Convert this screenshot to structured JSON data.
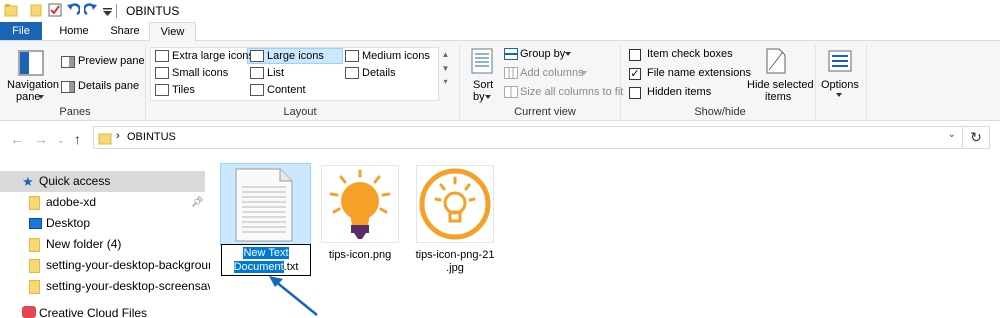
{
  "window": {
    "title": "OBINTUS"
  },
  "tabs": {
    "file": "File",
    "home": "Home",
    "share": "Share",
    "view": "View"
  },
  "ribbon": {
    "panes": {
      "label": "Panes",
      "navigation_pane_line1": "Navigation",
      "navigation_pane_line2": "pane",
      "preview_pane": "Preview pane",
      "details_pane": "Details pane"
    },
    "layout": {
      "label": "Layout",
      "extra_large_icons": "Extra large icons",
      "large_icons": "Large icons",
      "medium_icons": "Medium icons",
      "small_icons": "Small icons",
      "list": "List",
      "details": "Details",
      "tiles": "Tiles",
      "content": "Content",
      "selected": "Large icons"
    },
    "current_view": {
      "label": "Current view",
      "sort_by_line1": "Sort",
      "sort_by_line2": "by",
      "group_by": "Group by",
      "add_columns": "Add columns",
      "size_all_columns": "Size all columns to fit"
    },
    "show_hide": {
      "label": "Show/hide",
      "item_check_boxes": "Item check boxes",
      "item_check_boxes_checked": false,
      "file_name_extensions": "File name extensions",
      "file_name_extensions_checked": true,
      "hidden_items": "Hidden items",
      "hidden_items_checked": false,
      "hide_selected_line1": "Hide selected",
      "hide_selected_line2": "items"
    },
    "options": {
      "label": "Options"
    }
  },
  "address_bar": {
    "path": "OBINTUS"
  },
  "sidebar": {
    "items": [
      {
        "label": "Quick access",
        "icon": "star-icon"
      },
      {
        "label": "adobe-xd",
        "icon": "folder-icon",
        "pinned": true
      },
      {
        "label": "Desktop",
        "icon": "desktop-icon"
      },
      {
        "label": "New folder (4)",
        "icon": "folder-icon"
      },
      {
        "label": "setting-your-desktop-background",
        "icon": "folder-icon"
      },
      {
        "label": "setting-your-desktop-screensaver",
        "icon": "folder-icon"
      },
      {
        "label": "Creative Cloud Files",
        "icon": "cloud-icon"
      }
    ]
  },
  "files": [
    {
      "name_editing_selected": "New Text Document",
      "name_suffix": ".txt",
      "type": "text-document-icon",
      "renaming": true
    },
    {
      "name": "tips-icon.png",
      "type": "lightbulb-image"
    },
    {
      "name_line1": "tips-icon-png-21",
      "name_line2": ".jpg",
      "type": "lightbulb-circle-image"
    }
  ],
  "colors": {
    "file_tab": "#1a64b6",
    "selection": "#cce8ff",
    "text_selection": "#0078d7",
    "arrow": "#1565c0",
    "bulb_orange": "#f4a125"
  }
}
